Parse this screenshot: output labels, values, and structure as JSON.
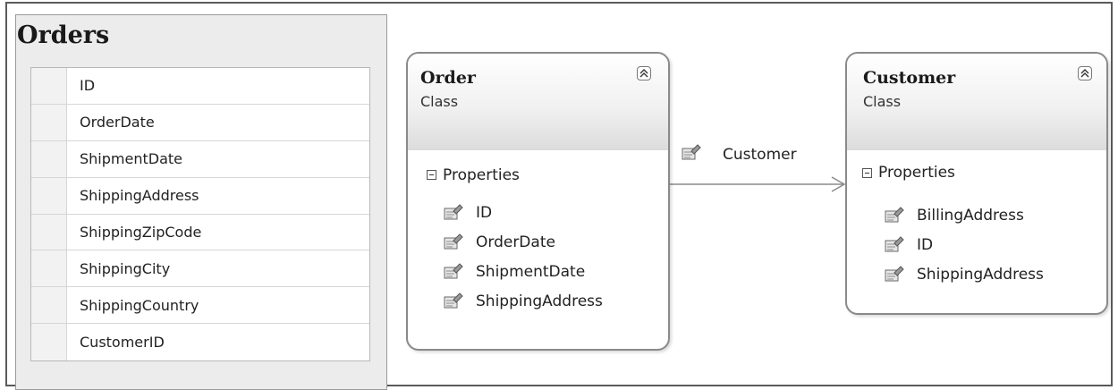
{
  "orders_table": {
    "title": "Orders",
    "columns": [
      "ID",
      "OrderDate",
      "ShipmentDate",
      "ShippingAddress",
      "ShippingZipCode",
      "ShippingCity",
      "ShippingCountry",
      "CustomerID"
    ]
  },
  "order_class": {
    "name": "Order",
    "kind": "Class",
    "section": "Properties",
    "properties": [
      "ID",
      "OrderDate",
      "ShipmentDate",
      "ShippingAddress"
    ]
  },
  "customer_class": {
    "name": "Customer",
    "kind": "Class",
    "section": "Properties",
    "properties": [
      "BillingAddress",
      "ID",
      "ShippingAddress"
    ]
  },
  "association": {
    "label": "Customer"
  },
  "icons": {
    "property": "property-icon",
    "collapse": "double-chevron-up-icon",
    "section_toggle": "minus-box-icon"
  }
}
